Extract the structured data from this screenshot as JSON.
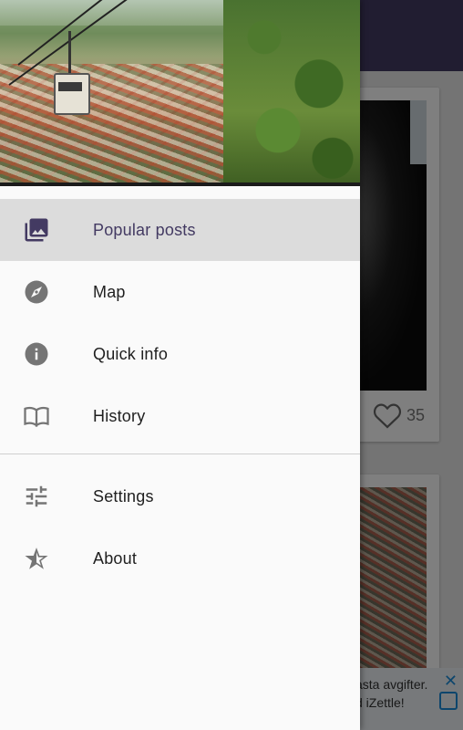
{
  "background": {
    "card_likes_count": "35",
    "ad_text_line1": "asta avgifter.",
    "ad_text_line2": "d iZettle!"
  },
  "drawer": {
    "header_image_alt": "Cable car over city hillside",
    "primary_items": [
      {
        "label": "Popular posts",
        "icon": "photo-library-icon",
        "active": true
      },
      {
        "label": "Map",
        "icon": "compass-icon",
        "active": false
      },
      {
        "label": "Quick info",
        "icon": "info-icon",
        "active": false
      },
      {
        "label": "History",
        "icon": "book-icon",
        "active": false
      }
    ],
    "secondary_items": [
      {
        "label": "Settings",
        "icon": "sliders-icon"
      },
      {
        "label": "About",
        "icon": "star-icon"
      }
    ]
  },
  "colors": {
    "primary": "#433a62",
    "icon_gray": "#757575",
    "active_bg": "#dcdcdc"
  }
}
